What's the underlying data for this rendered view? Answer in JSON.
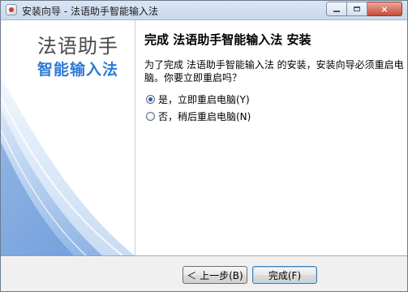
{
  "window": {
    "title": "安装向导 - 法语助手智能输入法",
    "app_icon": "installer-icon",
    "controls": {
      "minimize": "minimize-icon",
      "maximize": "maximize-icon",
      "close": "×"
    }
  },
  "banner": {
    "title": "法语助手",
    "subtitle": "智能输入法",
    "accent_color": "#2d7ad6"
  },
  "main": {
    "heading": "完成 法语助手智能输入法 安装",
    "description": "为了完成 法语助手智能输入法 的安装，安装向导必须重启电脑。你要立即重启吗？",
    "options": [
      {
        "label": "是，立即重启电脑(Y)",
        "checked": true
      },
      {
        "label": "否，稍后重启电脑(N)",
        "checked": false
      }
    ]
  },
  "footer": {
    "back_label": "＜ 上一步(B)",
    "finish_label": "完成(F)"
  }
}
